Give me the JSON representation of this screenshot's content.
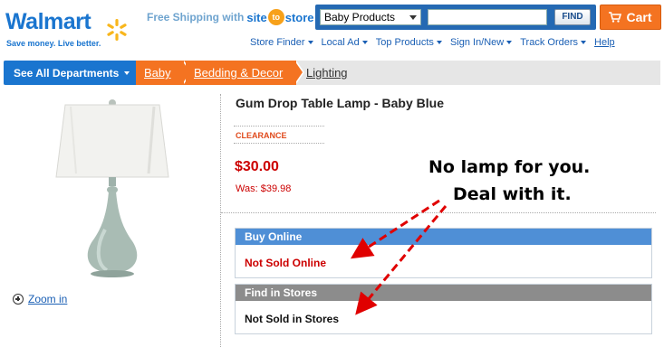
{
  "header": {
    "logo_text": "Walmart",
    "logo_tagline": "Save money. Live better.",
    "shipping_text": "Free Shipping with",
    "site_to_store_parts": [
      "site",
      "to",
      "store"
    ],
    "search": {
      "department_selected": "Baby Products",
      "query_value": "",
      "find_label": "FIND"
    },
    "cart_label": "Cart",
    "utility_nav": [
      {
        "label": "Store Finder"
      },
      {
        "label": "Local Ad"
      },
      {
        "label": "Top Products"
      },
      {
        "label": "Sign In/New"
      },
      {
        "label": "Track Orders"
      }
    ],
    "help_label": "Help"
  },
  "breadcrumb": {
    "departments_label": "See All Departments",
    "items": [
      "Baby",
      "Bedding & Decor",
      "Lighting"
    ]
  },
  "product": {
    "title": "Gum Drop Table Lamp - Baby Blue",
    "badge": "CLEARANCE",
    "price": "$30.00",
    "was_price": "Was: $39.98",
    "zoom_label": "Zoom in",
    "buy_online": {
      "heading": "Buy Online",
      "status": "Not Sold Online"
    },
    "find_in_stores": {
      "heading": "Find in Stores",
      "status": "Not Sold in Stores"
    }
  },
  "annotation": {
    "line1": "No lamp for you.",
    "line2": "Deal with it."
  },
  "colors": {
    "brand_blue": "#1a75cf",
    "orange": "#f47321",
    "price_red": "#cc0000",
    "arrow_red": "#e00000"
  },
  "icons": [
    "spark-logo-icon",
    "chevron-down-icon",
    "cart-icon",
    "zoom-plus-icon",
    "arrow-icon"
  ]
}
